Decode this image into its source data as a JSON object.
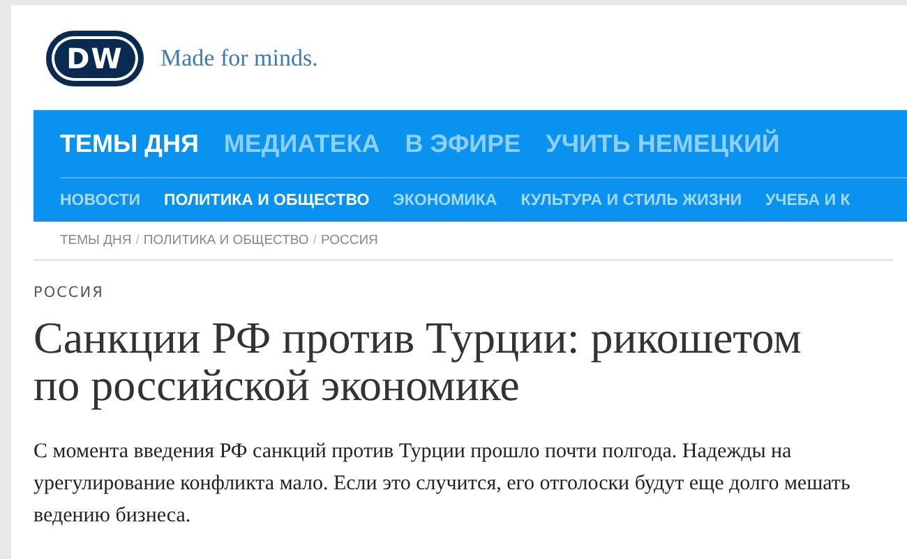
{
  "header": {
    "logo": "DW",
    "tagline": "Made for minds."
  },
  "main_nav": [
    {
      "label": "ТЕМЫ ДНЯ",
      "selected": true
    },
    {
      "label": "МЕДИАТЕКА",
      "selected": false
    },
    {
      "label": "В ЭФИРЕ",
      "selected": false
    },
    {
      "label": "УЧИТЬ НЕМЕЦКИЙ",
      "selected": false
    }
  ],
  "sub_nav": [
    {
      "label": "НОВОСТИ",
      "selected": false
    },
    {
      "label": "ПОЛИТИКА И ОБЩЕСТВО",
      "selected": true
    },
    {
      "label": "ЭКОНОМИКА",
      "selected": false
    },
    {
      "label": "КУЛЬТУРА И СТИЛЬ ЖИЗНИ",
      "selected": false
    },
    {
      "label": "УЧЕБА И К",
      "selected": false
    }
  ],
  "breadcrumb": [
    {
      "kind": "link",
      "text": "ТЕМЫ ДНЯ"
    },
    {
      "kind": "separator",
      "text": "/"
    },
    {
      "kind": "link",
      "text": "ПОЛИТИКА И ОБЩЕСТВО"
    },
    {
      "kind": "separator",
      "text": "/"
    },
    {
      "kind": "link",
      "text": "РОССИЯ"
    }
  ],
  "article": {
    "section": "РОССИЯ",
    "title": "Санкции РФ против Турции: рикошетом по российской экономике",
    "lead": "С момента введения РФ санкций против Турции прошло почти полгода. Надежды на урегулирование конфликта мало. Если это случится, его отголоски будут еще долго мешать ведению бизнеса."
  }
}
